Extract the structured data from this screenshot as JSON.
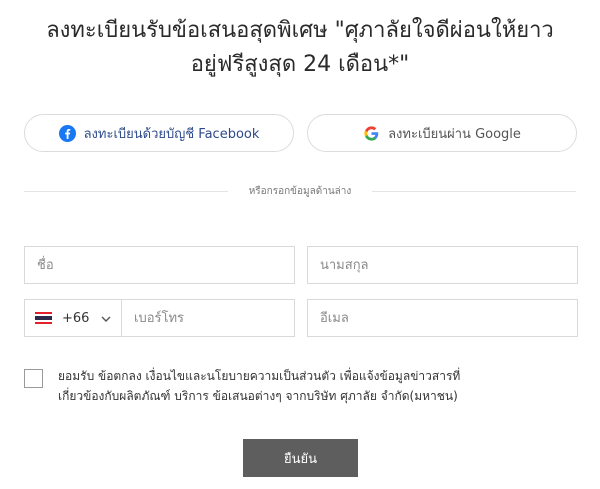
{
  "title": {
    "line1": "ลงทะเบียนรับข้อเสนอสุดพิเศษ \"ศุภาลัยใจดีผ่อนให้ยาว",
    "line2": "อยู่ฟรีสูงสุด 24 เดือน*\""
  },
  "social": {
    "facebook_label": "ลงทะเบียนด้วยบัญชี Facebook",
    "google_label": "ลงทะเบียนผ่าน Google"
  },
  "divider_text": "หรือกรอกข้อมูลด้านล่าง",
  "form": {
    "first_name_placeholder": "ชื่อ",
    "last_name_placeholder": "นามสกุล",
    "phone_code": "+66",
    "phone_placeholder": "เบอร์โทร",
    "email_placeholder": "อีเมล"
  },
  "consent": {
    "line1": "ยอมรับ ข้อตกลง เงื่อนไขและนโยบายความเป็นส่วนตัว เพื่อแจ้งข้อมูลข่าวสารที่",
    "line2": "เกี่ยวข้องกับผลิตภัณฑ์ บริการ ข้อเสนอต่างๆ จากบริษัท ศุภาลัย จำกัด(มหาชน)"
  },
  "submit_label": "ยืนยัน",
  "icons": {
    "facebook": "facebook-icon",
    "google": "google-icon",
    "flag": "thailand-flag-icon",
    "chevron": "chevron-down-icon"
  },
  "colors": {
    "facebook_blue": "#1877f2",
    "facebook_text": "#2d4a8a",
    "submit_bg": "#5e5e5e"
  }
}
